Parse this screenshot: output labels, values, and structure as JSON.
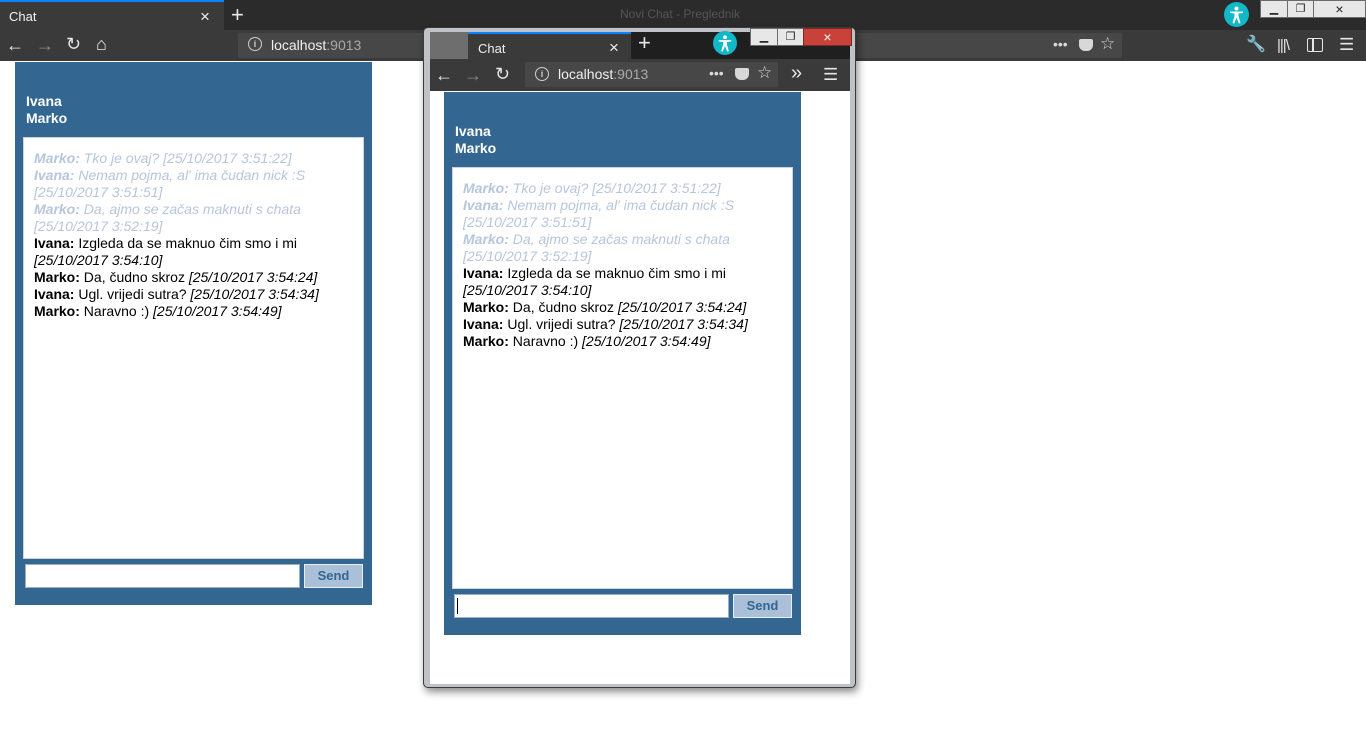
{
  "main_browser": {
    "tab_title": "Chat",
    "window_title": "Novi Chat - Preglednik",
    "url_host": "localhost",
    "url_port": ":9013"
  },
  "popup_browser": {
    "tab_title": "Chat",
    "url_host": "localhost",
    "url_port": ":9013"
  },
  "icons": {
    "close_tab": "×",
    "new_tab": "+",
    "back": "←",
    "forward": "→",
    "reload": "↻",
    "home": "⌂",
    "more": "•••",
    "bookmark": "☆",
    "overflow": "»",
    "menu": "☰",
    "accessibility": "accessibility-icon",
    "minimize": "▁",
    "restore": "❐",
    "close_window": "×"
  },
  "colors": {
    "panel": "#336690",
    "send_button": "#a9c0d8",
    "old_message": "#b6c6dc",
    "accessibility": "#12b7c8"
  },
  "chat": {
    "users": [
      "Ivana",
      "Marko"
    ],
    "messages": [
      {
        "user": "Marko:",
        "text": " Tko je ovaj? ",
        "time": "[25/10/2017 3:51:22]",
        "old": true
      },
      {
        "user": "Ivana:",
        "text": " Nemam pojma, al' ima čudan nick :S ",
        "time": "[25/10/2017 3:51:51]",
        "old": true
      },
      {
        "user": "Marko:",
        "text": " Da, ajmo se začas maknuti s chata ",
        "time": "[25/10/2017 3:52:19]",
        "old": true
      },
      {
        "user": "Ivana:",
        "text": " Izgleda da se maknuo čim smo i mi ",
        "time": "[25/10/2017 3:54:10]",
        "old": false
      },
      {
        "user": "Marko:",
        "text": " Da, čudno skroz ",
        "time": "[25/10/2017 3:54:24]",
        "old": false
      },
      {
        "user": "Ivana:",
        "text": " Ugl. vrijedi sutra? ",
        "time": "[25/10/2017 3:54:34]",
        "old": false
      },
      {
        "user": "Marko:",
        "text": " Naravno :) ",
        "time": "[25/10/2017 3:54:49]",
        "old": false
      }
    ],
    "send_label": "Send",
    "input_value": ""
  }
}
